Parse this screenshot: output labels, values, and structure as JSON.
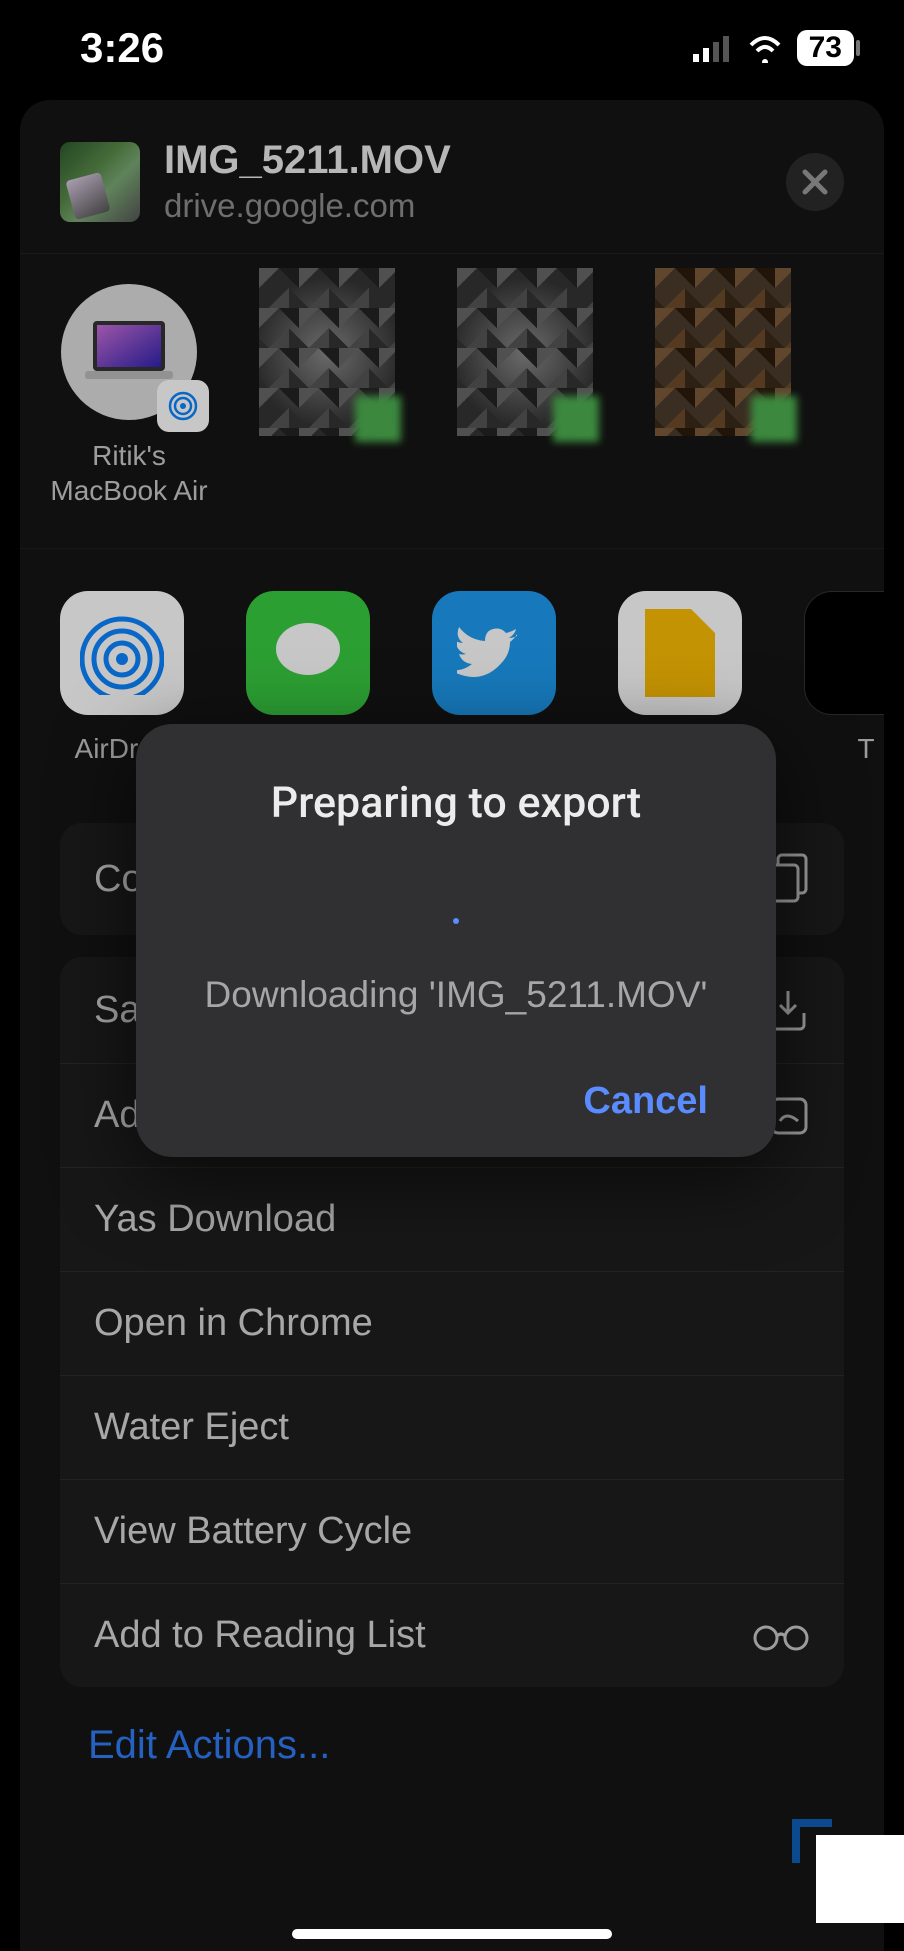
{
  "statusbar": {
    "time": "3:26",
    "battery_percent": "73"
  },
  "sheet": {
    "filename": "IMG_5211.MOV",
    "source": "drive.google.com"
  },
  "contacts": [
    {
      "label": "Ritik's\nMacBook Air",
      "type": "device"
    },
    {
      "label": "",
      "type": "pixelated"
    },
    {
      "label": "",
      "type": "pixelated"
    },
    {
      "label": "",
      "type": "pixelated-brown"
    }
  ],
  "apps": [
    {
      "label": "AirDrop",
      "icon": "airdrop"
    },
    {
      "label": "Messages",
      "icon": "msg"
    },
    {
      "label": "Twitter",
      "icon": "tw"
    },
    {
      "label": "Keep",
      "icon": "keep"
    },
    {
      "label": "T",
      "icon": "dark"
    }
  ],
  "actions": {
    "copy": "Copy",
    "group": [
      {
        "label": "Save Video",
        "icon": "download"
      },
      {
        "label": "Add to New Quick Note",
        "icon": "note"
      },
      {
        "label": "Yas Download",
        "icon": ""
      },
      {
        "label": "Open in Chrome",
        "icon": ""
      },
      {
        "label": "Water Eject",
        "icon": ""
      },
      {
        "label": "View Battery Cycle",
        "icon": ""
      },
      {
        "label": "Add to Reading List",
        "icon": "glasses"
      }
    ],
    "edit": "Edit Actions..."
  },
  "dialog": {
    "title": "Preparing to export",
    "message": "Downloading 'IMG_5211.MOV'",
    "cancel": "Cancel"
  }
}
